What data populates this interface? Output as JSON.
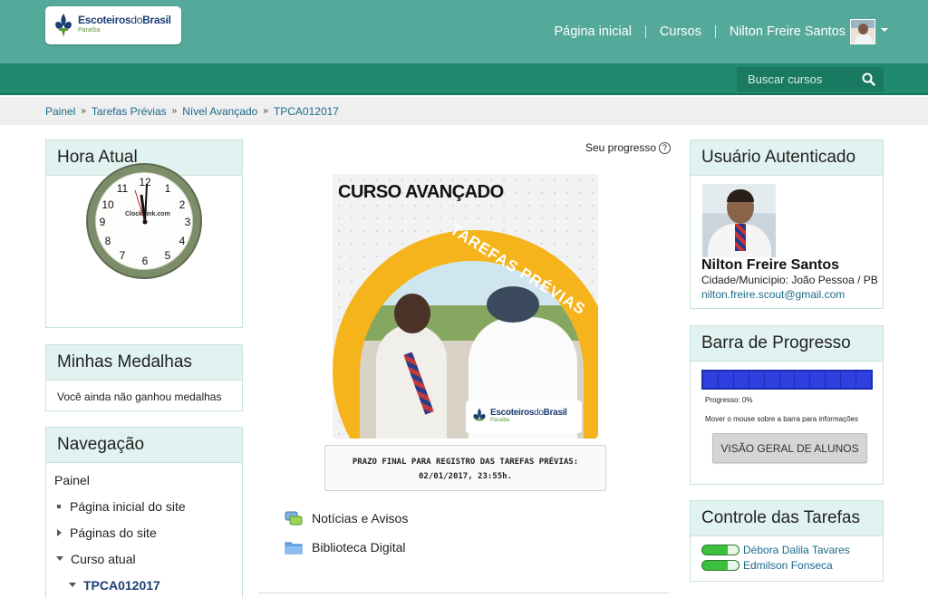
{
  "header": {
    "logo_main": "Escoteiros",
    "logo_do": "do",
    "logo_brasil": "Brasil",
    "logo_sub": "Paraíba",
    "nav": [
      "Página inicial",
      "Cursos"
    ],
    "user_name": "Nilton Freire Santos"
  },
  "search": {
    "placeholder": "Buscar cursos"
  },
  "breadcrumb": [
    "Painel",
    "Tarefas Prévias",
    "Nível Avançado",
    "TPCA012017"
  ],
  "left": {
    "clock": {
      "title": "Hora Atual",
      "brand": "ClockLink.com",
      "numbers": [
        "12",
        "1",
        "2",
        "3",
        "4",
        "5",
        "6",
        "7",
        "8",
        "9",
        "10",
        "11"
      ]
    },
    "medals": {
      "title": "Minhas Medalhas",
      "text": "Você ainda não ganhou medalhas"
    },
    "navigation": {
      "title": "Navegação",
      "items": [
        "Painel",
        "Página inicial do site",
        "Páginas do site",
        "Curso atual",
        "TPCA012017"
      ]
    }
  },
  "center": {
    "progress_label": "Seu progresso",
    "progress_help": "?",
    "banner": {
      "title": "CURSO AVANÇADO",
      "arc_text": "TAREFAS PRÉVIAS"
    },
    "notice_line1": "PRAZO FINAL PARA REGISTRO DAS TAREFAS PRÉVIAS:",
    "notice_line2": "02/01/2017, 23:55h.",
    "resources": [
      "Notícias e Avisos",
      "Biblioteca Digital"
    ]
  },
  "right": {
    "user_block": {
      "title": "Usuário Autenticado",
      "name": "Nilton Freire Santos",
      "city": "Cidade/Município: João Pessoa / PB",
      "email": "nilton.freire.scout@gmail.com"
    },
    "progress_block": {
      "title": "Barra de Progresso",
      "segments": 11,
      "progress_text": "Progresso: 0%",
      "progress_percent": 0,
      "hint": "Mover o mouse sobre a barra para informações",
      "button": "VISÃO GERAL DE ALUNOS"
    },
    "tasks_block": {
      "title": "Controle das Tarefas",
      "people": [
        "Débora Dalila Tavares",
        "Edmilson Fonseca"
      ]
    }
  },
  "colors": {
    "header_bg": "#55a99a",
    "subbar_bg": "#1f8a6e",
    "block_header_bg": "#e1f3f1",
    "accent_yellow": "#f5b41b",
    "progress_blue": "#2f3fe0"
  }
}
